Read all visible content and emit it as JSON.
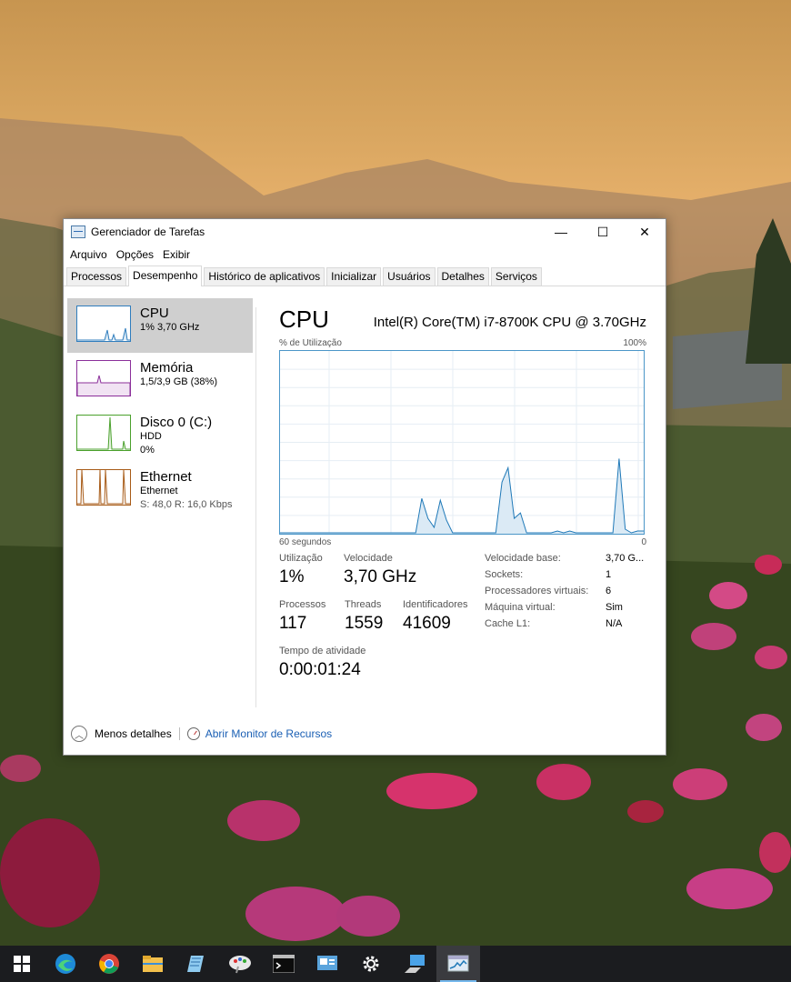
{
  "window": {
    "title": "Gerenciador de Tarefas",
    "controls": {
      "minimize": "—",
      "maximize": "☐",
      "close": "✕"
    }
  },
  "menubar": [
    "Arquivo",
    "Opções",
    "Exibir"
  ],
  "tabs": [
    {
      "label": "Processos",
      "active": false
    },
    {
      "label": "Desempenho",
      "active": true
    },
    {
      "label": "Histórico de aplicativos",
      "active": false
    },
    {
      "label": "Inicializar",
      "active": false
    },
    {
      "label": "Usuários",
      "active": false
    },
    {
      "label": "Detalhes",
      "active": false
    },
    {
      "label": "Serviços",
      "active": false
    }
  ],
  "sidebar": [
    {
      "title": "CPU",
      "line1": "1% 3,70 GHz",
      "line2": "",
      "color": "#2f7dbd",
      "selected": true
    },
    {
      "title": "Memória",
      "line1": "1,5/3,9 GB (38%)",
      "line2": "",
      "color": "#8b2f9a",
      "selected": false
    },
    {
      "title": "Disco 0 (C:)",
      "line1": "HDD",
      "line2": "0%",
      "color": "#4aa02c",
      "selected": false
    },
    {
      "title": "Ethernet",
      "line1": "Ethernet",
      "line2": "S: 48,0 R: 16,0 Kbps",
      "color": "#a75a16",
      "selected": false
    }
  ],
  "main": {
    "heading": "CPU",
    "model": "Intel(R) Core(TM) i7-8700K CPU @ 3.70GHz",
    "graph": {
      "y_label": "% de Utilização",
      "y_max_label": "100%",
      "x_left_label": "60 segundos",
      "x_right_label": "0",
      "line_color": "#1f79b8",
      "fill_color": "#dbeaf5",
      "grid_color": "#e6eef4",
      "samples": [
        0,
        0,
        0,
        0,
        0,
        0,
        0,
        0,
        0,
        0,
        0,
        0,
        0,
        0,
        0,
        0,
        0,
        0,
        0,
        0,
        0,
        0,
        0,
        19,
        8,
        3,
        18,
        7,
        0,
        0,
        0,
        0,
        0,
        0,
        0,
        0,
        28,
        36,
        8,
        11,
        0,
        0,
        0,
        0,
        0,
        1,
        0,
        1,
        0,
        0,
        0,
        0,
        0,
        0,
        0,
        41,
        2,
        0,
        1,
        1
      ]
    },
    "stats": {
      "utilizacao": {
        "label": "Utilização",
        "value": "1%"
      },
      "velocidade": {
        "label": "Velocidade",
        "value": "3,70 GHz"
      },
      "processos": {
        "label": "Processos",
        "value": "117"
      },
      "threads": {
        "label": "Threads",
        "value": "1559"
      },
      "identificadores": {
        "label": "Identificadores",
        "value": "41609"
      },
      "tempo": {
        "label": "Tempo de atividade",
        "value": "0:00:01:24"
      }
    },
    "specs": [
      {
        "key": "Velocidade base:",
        "value": "3,70 G..."
      },
      {
        "key": "Sockets:",
        "value": "1"
      },
      {
        "key": "Processadores virtuais:",
        "value": "6"
      },
      {
        "key": "Máquina virtual:",
        "value": "Sim"
      },
      {
        "key": "Cache L1:",
        "value": "N/A"
      }
    ]
  },
  "footer": {
    "less_details": "Menos detalhes",
    "resource_monitor": "Abrir Monitor de Recursos"
  },
  "taskbar": [
    {
      "name": "windows-start-icon",
      "active": false
    },
    {
      "name": "edge-icon",
      "active": false
    },
    {
      "name": "chrome-icon",
      "active": false
    },
    {
      "name": "file-explorer-icon",
      "active": false
    },
    {
      "name": "notepad-icon",
      "active": false
    },
    {
      "name": "paint-icon",
      "active": false
    },
    {
      "name": "command-prompt-icon",
      "active": false
    },
    {
      "name": "remote-desktop-icon",
      "active": false
    },
    {
      "name": "settings-gear-icon",
      "active": false
    },
    {
      "name": "network-icon",
      "active": false
    },
    {
      "name": "task-manager-icon",
      "active": true
    }
  ]
}
